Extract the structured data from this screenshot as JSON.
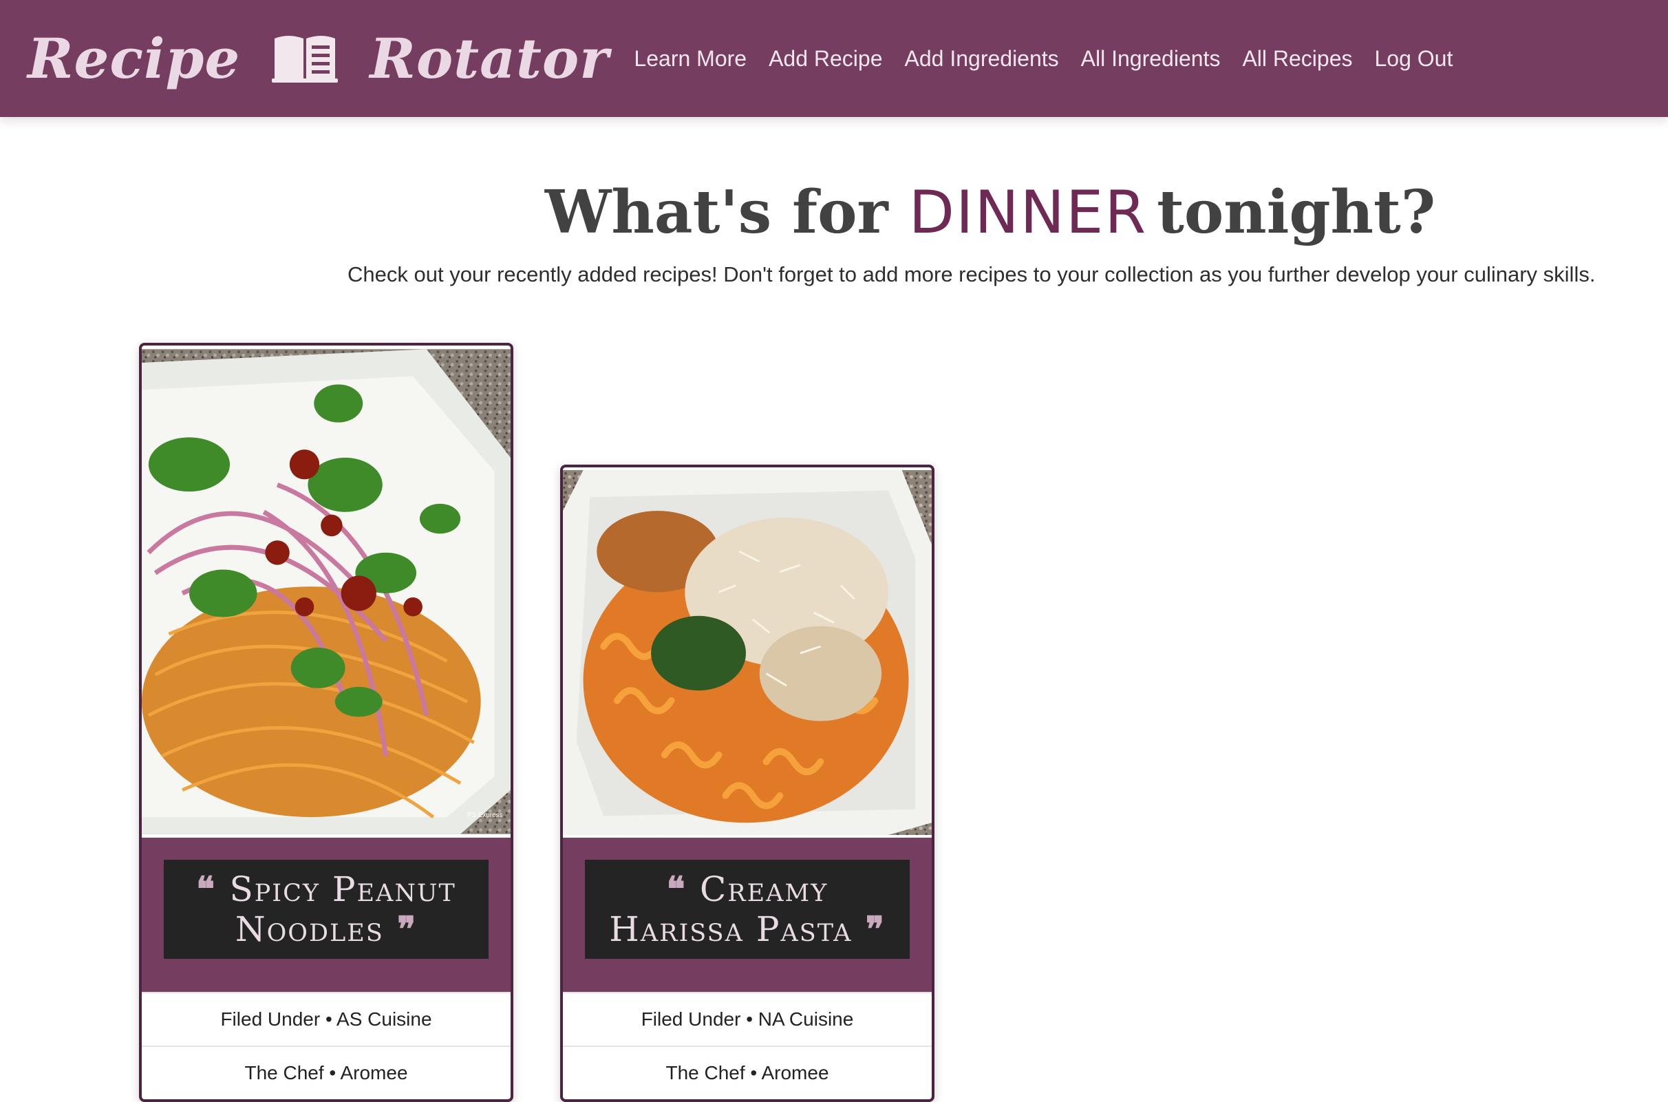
{
  "nav": {
    "brand_left": "Recipe",
    "brand_right": "Rotator",
    "brand_icon": "open-book-icon",
    "links": [
      "Learn More",
      "Add Recipe",
      "Add Ingredients",
      "All Ingredients",
      "All Recipes",
      "Log Out"
    ]
  },
  "hero": {
    "title_pre": "What's for",
    "title_accent": "DINNER",
    "title_post": "tonight?",
    "subtitle": "Check out your recently added recipes! Don't forget to add more recipes to your collection as you further develop your culinary skills."
  },
  "cards": [
    {
      "title": "Spicy Peanut Noodles",
      "category_label": "Filed Under",
      "category": "AS Cuisine",
      "chef_label": "The Chef",
      "chef": "Aromee",
      "watermark": "PS Express"
    },
    {
      "title": "Creamy Harissa Pasta",
      "category_label": "Filed Under",
      "category": "NA Cuisine",
      "chef_label": "The Chef",
      "chef": "Aromee"
    }
  ],
  "colors": {
    "brand": "#753d5f",
    "accent": "#6e2a55",
    "title_bg": "#242424"
  }
}
